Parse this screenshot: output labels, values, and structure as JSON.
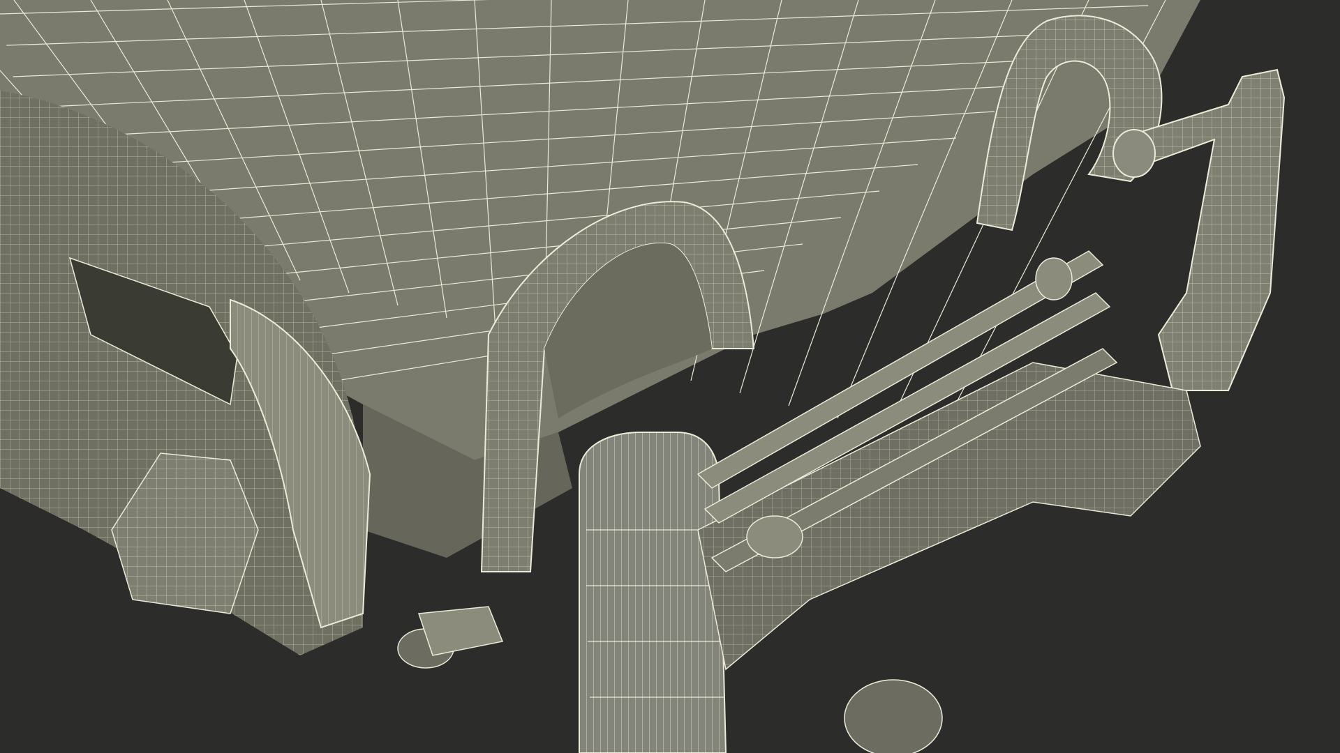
{
  "scene": {
    "subject": "hospital-bed-wireframe",
    "render_mode": "wireframe-on-shaded",
    "colors": {
      "background": "#2c2c2b",
      "surface": "#7a7b6c",
      "surface_dark": "#5f6053",
      "surface_light": "#8b8c7c",
      "wire": "#ecebd8"
    }
  }
}
